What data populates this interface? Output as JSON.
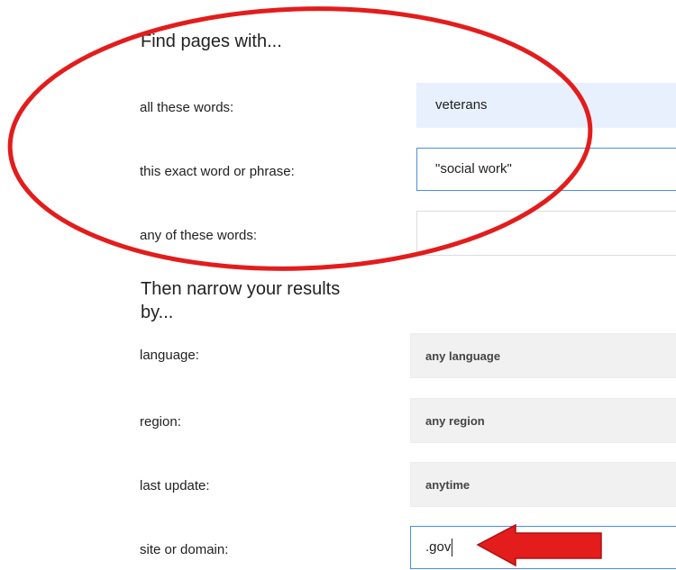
{
  "find_section": {
    "heading": "Find pages with...",
    "all_words": {
      "label": "all these words:",
      "value": "veterans"
    },
    "exact_phrase": {
      "label": "this exact word or phrase:",
      "value": "\"social work\""
    },
    "any_words": {
      "label": "any of these words:",
      "value": ""
    }
  },
  "narrow_section": {
    "heading_line1": "Then narrow your results",
    "heading_line2": "by...",
    "language": {
      "label": "language:",
      "value": "any language"
    },
    "region": {
      "label": "region:",
      "value": "any region"
    },
    "last_update": {
      "label": "last update:",
      "value": "anytime"
    },
    "site_domain": {
      "label": "site or domain:",
      "value": ".gov"
    }
  },
  "annotations": {
    "highlight_color": "#e31c1c",
    "shapes": [
      "ellipse-highlight",
      "arrow-pointer"
    ]
  }
}
